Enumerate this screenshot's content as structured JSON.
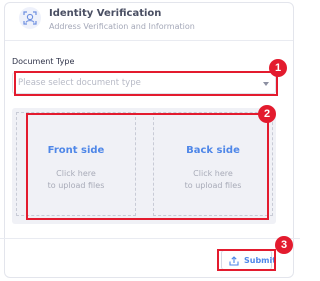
{
  "header": {
    "icon": "face-scan-icon",
    "title": "Identity Verification",
    "subtitle": "Address Verification and Information"
  },
  "document_type": {
    "label": "Document Type",
    "placeholder": "Please select document type",
    "caret_icon": "caret-down-icon"
  },
  "upload": {
    "front": {
      "title": "Front side",
      "hint_line1": "Click here",
      "hint_line2": "to upload files"
    },
    "back": {
      "title": "Back side",
      "hint_line1": "Click here",
      "hint_line2": "to upload files"
    }
  },
  "submit": {
    "label": "Submit",
    "icon": "upload-icon"
  },
  "annotations": [
    "1",
    "2",
    "3"
  ],
  "colors": {
    "accent": "#4f87e8",
    "annotation": "#e31b2e",
    "upload_bg": "#f0f1f6"
  }
}
